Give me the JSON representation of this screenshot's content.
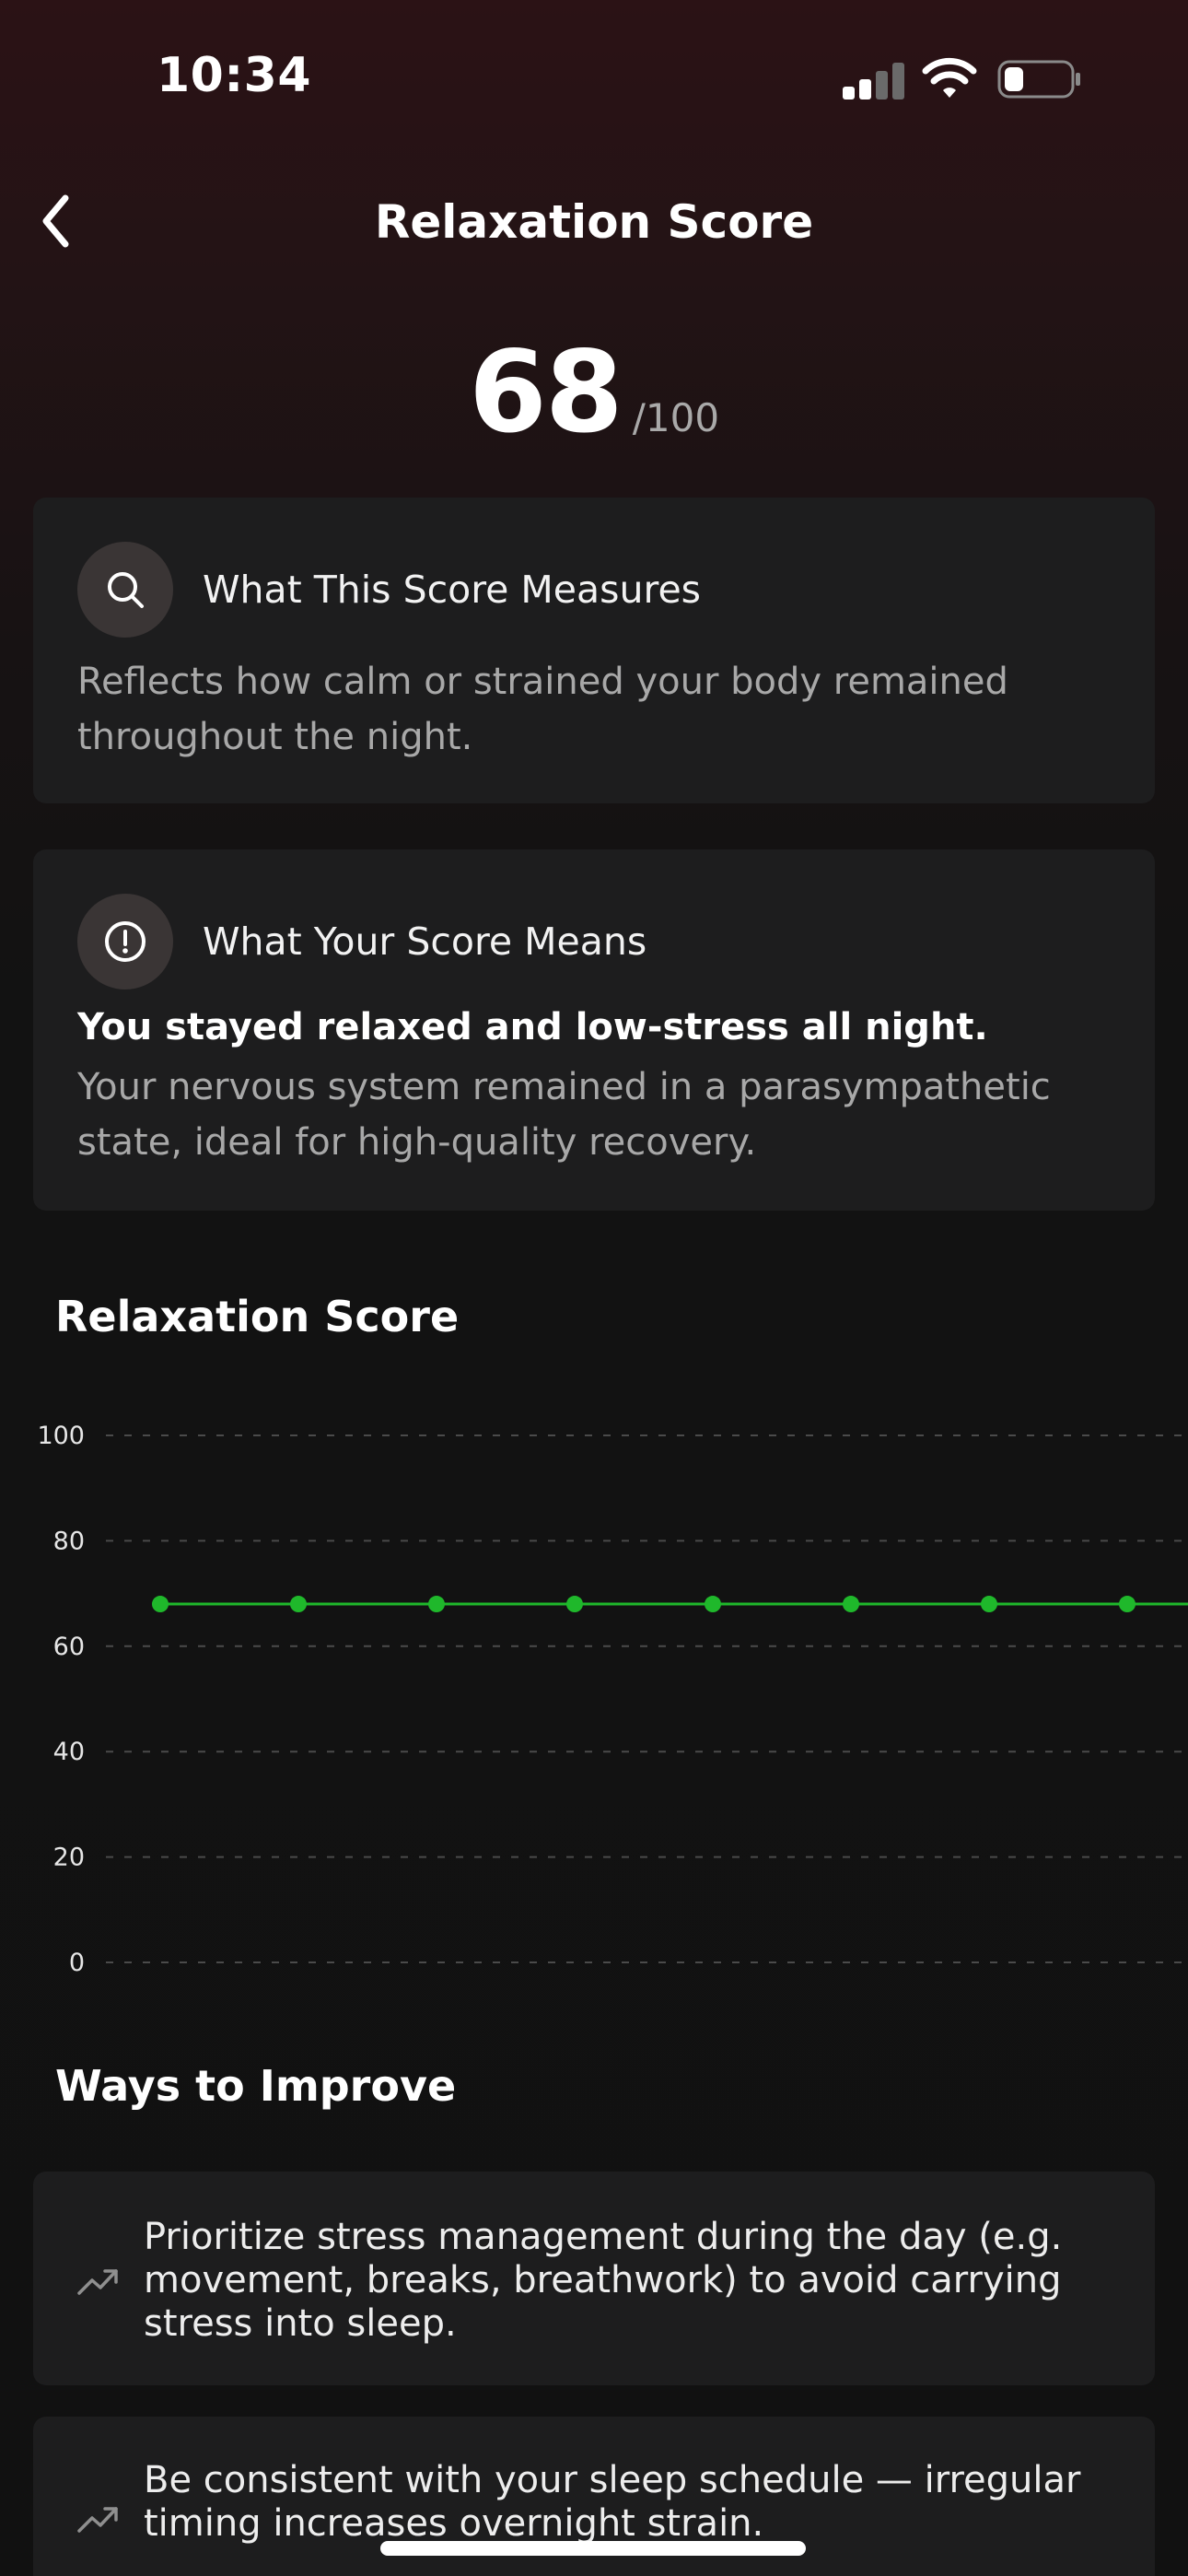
{
  "status_bar": {
    "time": "10:34"
  },
  "header": {
    "title": "Relaxation Score"
  },
  "score": {
    "value": "68",
    "max": "/100"
  },
  "measures_card": {
    "icon": "search-icon",
    "title": "What This Score Measures",
    "text": "Reflects how calm or strained your body remained throughout the night."
  },
  "meaning_card": {
    "icon": "alert-circle-icon",
    "title": "What Your Score Means",
    "headline": "You stayed relaxed and low-stress all night.",
    "text": "Your nervous system remained in a parasympathetic state, ideal for high-quality recovery."
  },
  "chart_section": {
    "title": "Relaxation Score"
  },
  "chart_data": {
    "type": "line",
    "title": "Relaxation Score",
    "y_ticks": [
      "100",
      "80",
      "60",
      "40",
      "20",
      "0"
    ],
    "ylim": [
      0,
      100
    ],
    "grid": true,
    "series": [
      {
        "color": "#1fb82b",
        "values": [
          68,
          68,
          68,
          68,
          68,
          68,
          68,
          68
        ]
      }
    ]
  },
  "improve": {
    "title": "Ways to Improve",
    "tips": [
      {
        "icon": "trending-up-icon",
        "text": "Prioritize stress management during the day (e.g. movement, breaks, breathwork) to avoid carrying stress into sleep."
      },
      {
        "icon": "trending-up-icon",
        "text": "Be consistent with your sleep schedule — irregular timing increases overnight strain."
      }
    ]
  }
}
